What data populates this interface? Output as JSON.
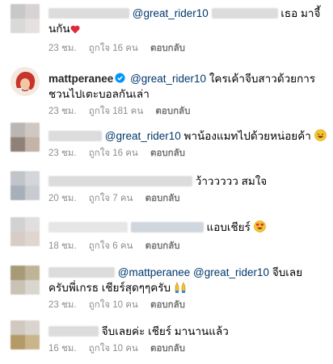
{
  "comments": [
    {
      "mention": "@great_rider10",
      "text": "เธอ มาจี้",
      "text2": "นกัน",
      "time": "23 ชม.",
      "likes": "ถูกใจ 16 คน",
      "reply": "ตอบกลับ"
    },
    {
      "username": "mattperanee",
      "mention": "@great_rider10",
      "text": "ใครเค้าจีบสาวด้วยการ",
      "text2": "ชวนไปเตะบอลกันเล่า",
      "time": "23 ชม.",
      "likes": "ถูกใจ 181 คน",
      "reply": "ตอบกลับ"
    },
    {
      "mention": "@great_rider10",
      "text": "พาน้องแมทไปด้วยหน่อยค้า",
      "time": "23 ชม.",
      "likes": "ถูกใจ 16 คน",
      "reply": "ตอบกลับ"
    },
    {
      "text": "ว้าววววว สมใจ",
      "time": "20 ชม.",
      "likes": "ถูกใจ 7 คน",
      "reply": "ตอบกลับ"
    },
    {
      "text": "แอบเชียร์",
      "time": "18 ชม.",
      "likes": "ถูกใจ 6 คน",
      "reply": "ตอบกลับ"
    },
    {
      "mention": "@mattperanee",
      "mention2": "@great_rider10",
      "text": "จีบเลย",
      "text2": "ครับพี่เกรธ เชียร์สุดๆๆครับ",
      "time": "23 ชม.",
      "likes": "ถูกใจ 10 คน",
      "reply": "ตอบกลับ"
    },
    {
      "text": "จีบเลยค่ะ เชียร์ มานานแล้ว",
      "time": "16 ชม.",
      "likes": "ถูกใจ 10 คน",
      "reply": "ตอบกลับ"
    }
  ],
  "icons": {
    "heart": "heart-icon",
    "verified": "verified-badge-icon",
    "grin": "grinning-face-icon",
    "heart_eyes": "heart-eyes-face-icon",
    "praise": "raising-hands-icon"
  },
  "colors": {
    "mention": "#00376b",
    "meta": "#8e8e8e",
    "verified": "#0095f6"
  }
}
